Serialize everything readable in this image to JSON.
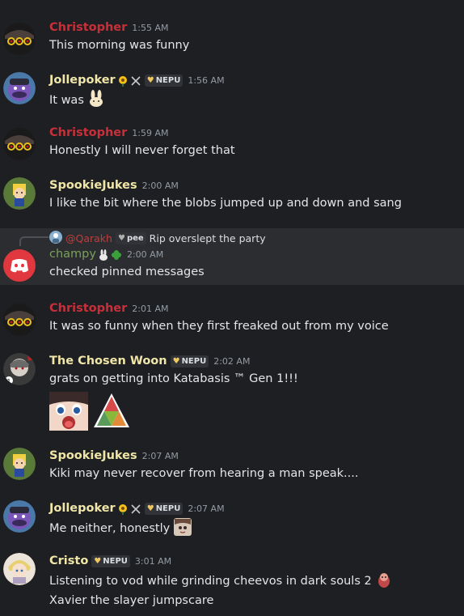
{
  "colors": {
    "background": "#1e1f22",
    "highlight_row": "#2b2d31",
    "christopher": "#c7303a",
    "gold": "#f0e6a8",
    "green": "#7ba05b",
    "reply_name": "#c53b3b",
    "timestamp": "#949ba4"
  },
  "messages": [
    {
      "author": "Christopher",
      "time": "1:55 AM",
      "lines": [
        "This morning was funny"
      ]
    },
    {
      "author": "Jollepoker",
      "tag": "NEPU",
      "time": "1:56 AM",
      "lines": [
        "It was"
      ],
      "icons": [
        "sunflower-icon",
        "crossed-swords-icon",
        "bunny-emoji"
      ]
    },
    {
      "author": "Christopher",
      "time": "1:59 AM",
      "lines": [
        "Honestly I will never forget that"
      ]
    },
    {
      "author": "SpookieJukes",
      "time": "2:00 AM",
      "lines": [
        "I like the bit where the blobs jumped up and down and sang"
      ]
    },
    {
      "author": "champy",
      "time": "2:00 AM",
      "lines": [
        "checked pinned messages"
      ],
      "icons": [
        "rabbit-icon",
        "clover-icon"
      ],
      "reply": {
        "author": "@Qarakh",
        "tag": "pee",
        "text": "Rip overslept the party"
      }
    },
    {
      "author": "Christopher",
      "time": "2:01 AM",
      "lines": [
        "It was so funny when they first freaked out from my voice"
      ]
    },
    {
      "author": "The Chosen Woon",
      "tag": "NEPU",
      "time": "2:02 AM",
      "lines": [
        "grats on getting into Katabasis ™ Gen 1!!!"
      ]
    },
    {
      "author": "SpookieJukes",
      "time": "2:07 AM",
      "lines": [
        "Kiki may never recover from hearing a man speak...."
      ]
    },
    {
      "author": "Jollepoker",
      "tag": "NEPU",
      "time": "2:07 AM",
      "lines": [
        "Me neither, honestly"
      ]
    },
    {
      "author": "Cristo",
      "tag": "NEPU",
      "time": "3:01 AM",
      "lines": [
        "Listening to vod while grinding cheevos in dark souls 2",
        "Xavier the slayer jumpscare"
      ]
    }
  ]
}
